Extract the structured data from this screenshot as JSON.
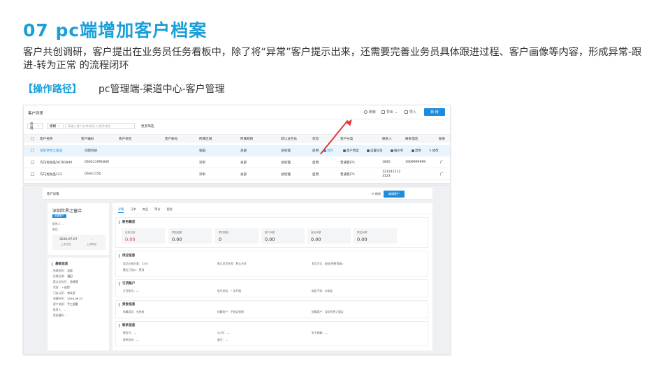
{
  "slide": {
    "title": "07  pc端增加客户档案",
    "description": "客户共创调研，客户提出在业务员任务看板中，除了将“异常”客户提示出来，还需要完善业务员具体跟进过程、客户画像等内容，形成异常-跟进-转为正常 的流程闭环",
    "path_label": "【操作路径】",
    "path_value": "pc管理端-渠道中心-客户管理"
  },
  "list": {
    "title": "客户列表",
    "refresh": "刷新",
    "export": "导出",
    "import": "导入",
    "new": "新 增",
    "status_filter": "启用",
    "match_filter": "模糊",
    "search_placeholder": "请输入客户名称/联系人/联系电话",
    "more_filter": "更多筛选",
    "columns": [
      "客户名称",
      "客户编码",
      "客户标签",
      "客户账号",
      "所属区域",
      "所属机构",
      "默认业务员",
      "状态",
      "客户分类",
      "联系人",
      "联系电话",
      "联系"
    ],
    "rows": [
      {
        "name": "深圳世界之窗店",
        "code": "创新的好",
        "region": "福田",
        "org": "总部",
        "salesman": "总经理",
        "status": "启用",
        "category": "",
        "contact": "",
        "phone": "",
        "extra": ""
      },
      {
        "name": "巧巧龙食品56781840",
        "code": "060311991840",
        "region": "深圳",
        "org": "总部",
        "salesman": "总经理",
        "status": "启用",
        "category": "普通客户1",
        "contact": "1840",
        "phone": "1909999999",
        "extra": "广"
      },
      {
        "name": "巧巧龙食品123",
        "code": "06031150",
        "region": "深圳",
        "org": "总部",
        "salesman": "总经理",
        "status": "启用",
        "category": "普通客户1",
        "contact": "121241212 3123",
        "phone": "",
        "extra": "广"
      }
    ],
    "actions": [
      "合作",
      "客户档案",
      "设置标签",
      "报价单",
      "禁用",
      "修改"
    ]
  },
  "detail": {
    "bar_title": "客户详情",
    "refresh": "刷新",
    "edit": "编辑客户",
    "profile": {
      "name": "深圳世界之窗店",
      "tag": "普通客户",
      "contact_label": "联系人：-",
      "phone_label": "电话：-",
      "stat1_value": "2026-07-07",
      "stat1_label": "上次订货",
      "stat2_value": "-",
      "stat2_label": "上次拜访"
    },
    "basic": {
      "title": "基础信息",
      "items": [
        {
          "k": "所属机构：",
          "v": "总部"
        },
        {
          "k": "所属区域：",
          "v": "福田"
        },
        {
          "k": "默认业务员：",
          "v": "总经理"
        },
        {
          "k": "状态：",
          "v": "• 启用"
        },
        {
          "k": "门店认证：",
          "v": "待认证"
        },
        {
          "k": "创建时间：",
          "v": "2026-06-23"
        },
        {
          "k": "客户来源：",
          "v": "手工创建"
        },
        {
          "k": "推荐人：",
          "v": "-"
        },
        {
          "k": "信息编码：",
          "v": "-"
        }
      ]
    },
    "tabs": [
      "详情",
      "订单",
      "商品",
      "拜访",
      "跟进"
    ],
    "finance": {
      "title": "财务概览",
      "boxes": [
        {
          "label": "应收欠款",
          "value": "0.00",
          "red": true
        },
        {
          "label": "预收金额",
          "value": "0.00",
          "red": false
        },
        {
          "label": "预付账款",
          "value": "0",
          "red": false
        },
        {
          "label": "账户余额",
          "value": "0.00",
          "red": false
        },
        {
          "label": "返利余额",
          "value": "0.00",
          "red": false
        },
        {
          "label": "预估余额",
          "value": "0.00",
          "red": false
        }
      ]
    },
    "supply": {
      "title": "供应信息",
      "items": [
        "商品价格方案：3333",
        "默认发货仓库：默认仓库",
        "发货方式：配送(预售等级)",
        "最近订货价：费用"
      ]
    },
    "order": {
      "title": "订货账户",
      "items": [
        "订货账号：---",
        "账号状态：• 未开通",
        "绑定手机：未绑定"
      ]
    },
    "funds": {
      "title": "资金信息",
      "items": [
        "结算类型：先结账",
        "结算账户：不限定账期",
        "结算客户：深圳世界之窗店"
      ]
    },
    "contact": {
      "title": "联系信息",
      "items": [
        "微信号：---",
        "QQ号：---",
        "电子邮箱：---",
        "联系地址：---",
        "备注：---"
      ]
    }
  }
}
